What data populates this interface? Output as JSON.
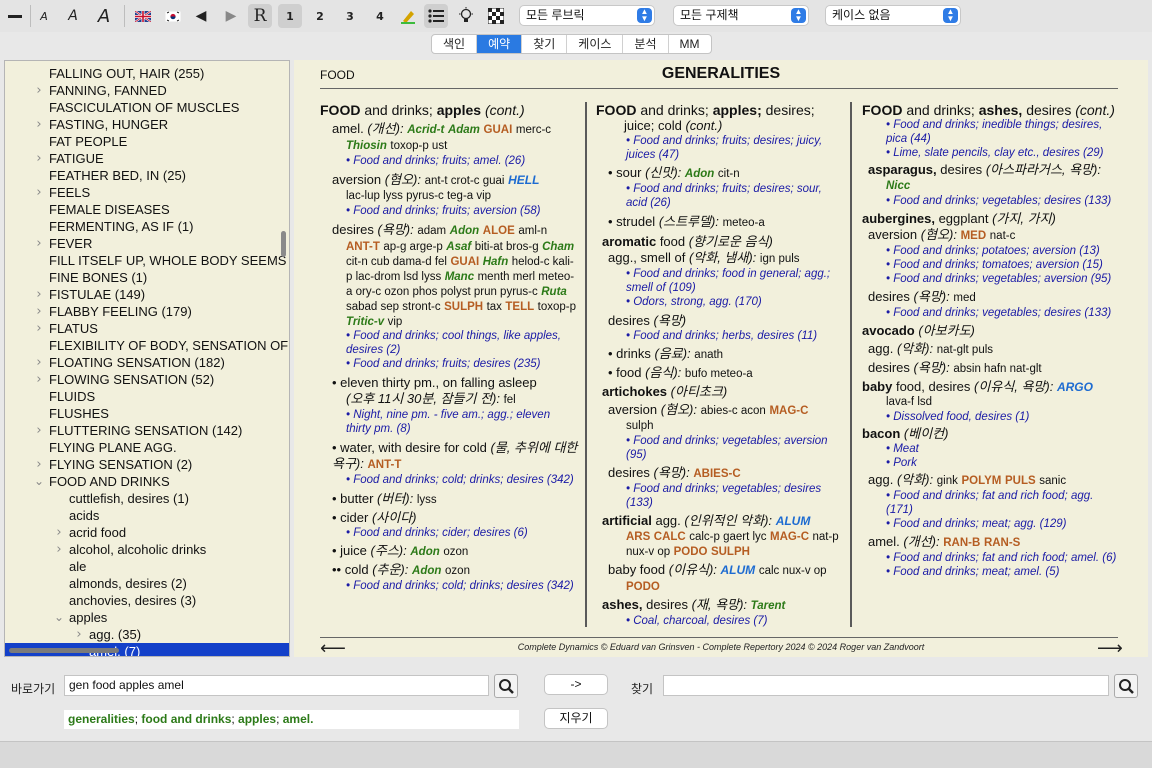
{
  "toolbar": {
    "font_sizes": [
      "A",
      "A",
      "A"
    ],
    "rep_letter": "R",
    "levels": [
      "1",
      "2",
      "3",
      "4"
    ],
    "dropdowns": [
      "모든 루브릭",
      "모든 구제책",
      "케이스 없음"
    ]
  },
  "tabs": [
    "색인",
    "예약",
    "찾기",
    "케이스",
    "분석",
    "MM"
  ],
  "active_tab": "예약",
  "tree": {
    "items": [
      {
        "label": "FALLING OUT, HAIR (255)",
        "expandable": false
      },
      {
        "label": "FANNING, FANNED",
        "expandable": true
      },
      {
        "label": "FASCICULATION OF MUSCLES",
        "expandable": false
      },
      {
        "label": "FASTING, HUNGER",
        "expandable": true
      },
      {
        "label": "FAT PEOPLE",
        "expandable": false
      },
      {
        "label": "FATIGUE",
        "expandable": true
      },
      {
        "label": "FEATHER BED, IN (25)",
        "expandable": false
      },
      {
        "label": "FEELS",
        "expandable": true
      },
      {
        "label": "FEMALE DISEASES",
        "expandable": false
      },
      {
        "label": "FERMENTING, AS IF (1)",
        "expandable": false
      },
      {
        "label": "FEVER",
        "expandable": true
      },
      {
        "label": "FILL ITSELF UP, WHOLE BODY SEEMS",
        "expandable": false
      },
      {
        "label": "FINE BONES (1)",
        "expandable": false
      },
      {
        "label": "FISTULAE (149)",
        "expandable": true
      },
      {
        "label": "FLABBY FEELING (179)",
        "expandable": true
      },
      {
        "label": "FLATUS",
        "expandable": true
      },
      {
        "label": "FLEXIBILITY OF BODY, SENSATION OF",
        "expandable": false
      },
      {
        "label": "FLOATING SENSATION (182)",
        "expandable": true
      },
      {
        "label": "FLOWING SENSATION (52)",
        "expandable": true
      },
      {
        "label": "FLUIDS",
        "expandable": false
      },
      {
        "label": "FLUSHES",
        "expandable": false
      },
      {
        "label": "FLUTTERING SENSATION (142)",
        "expandable": true
      },
      {
        "label": "FLYING PLANE AGG.",
        "expandable": false
      },
      {
        "label": "FLYING SENSATION (2)",
        "expandable": true
      },
      {
        "label": "FOOD AND DRINKS",
        "expandable": true,
        "open": true
      },
      {
        "label": "cuttlefish, desires (1)",
        "level": 1
      },
      {
        "label": "acids",
        "level": 1
      },
      {
        "label": "acrid food",
        "level": 1,
        "expandable": true
      },
      {
        "label": "alcohol, alcoholic drinks",
        "level": 1,
        "expandable": true
      },
      {
        "label": "ale",
        "level": 1
      },
      {
        "label": "almonds, desires (2)",
        "level": 1
      },
      {
        "label": "anchovies, desires (3)",
        "level": 1
      },
      {
        "label": "apples",
        "level": 1,
        "expandable": true,
        "open": true
      },
      {
        "label": "agg. (35)",
        "level": 2,
        "expandable": true
      },
      {
        "label": "amel. (7)",
        "level": 2,
        "selected": true
      }
    ]
  },
  "content": {
    "crumb": "FOOD",
    "title": "GENERALITIES",
    "copyright": "Complete Dynamics © Eduard van Grinsven   -   Complete Repertory 2024 © 2024 Roger van Zandvoort",
    "col1": {
      "heading_bold": "FOOD",
      "heading_mid": " and drinks; ",
      "heading_bold2": "apples",
      "heading_cont": " (cont.)",
      "amel_label": "amel.",
      "amel_kr": "(개선):",
      "amel_r2a": "Acrid-t",
      "amel_r2b": "Adam",
      "amel_r3a": "GUAI",
      "amel_r1a": "merc-c",
      "amel_r2c": "Thiosin",
      "amel_r1b": "toxop-p ust",
      "amel_xref": "• Food and drinks; fruits; amel. (26)",
      "aversion_label": "aversion",
      "aversion_kr": "(혐오):",
      "aversion_r1a": "ant-t crot-c guai",
      "aversion_r4": "HELL",
      "aversion_r1b": "lac-lup lyss pyrus-c teg-a vip",
      "aversion_xref": "• Food and drinks; fruits; aversion (58)",
      "desires_label": "desires",
      "desires_kr": "(욕망):",
      "d_adam": "adam",
      "d_adon": "Adon",
      "d_aloe": "ALOE",
      "d_amln": "aml-n",
      "d_antt": "ANT-T",
      "d_apg": "ap-g arge-p",
      "d_asaf": "Asaf",
      "d_biti": "biti-at bros-g",
      "d_cham": "Cham",
      "d_citn": "cit-n cub dama-d fel",
      "d_guai": "GUAI",
      "d_hafn": "Hafn",
      "d_helod": "helod-c kali-p lac-drom lsd lyss",
      "d_manc": "Manc",
      "d_menth": "menth merl meteo-a ory-c ozon phos polyst prun pyrus-c",
      "d_ruta": "Ruta",
      "d_sabad": "sabad sep stront-c",
      "d_sulph": "SULPH",
      "d_tax": "tax",
      "d_tell": "TELL",
      "d_toxop": "toxop-p",
      "d_tritic": "Tritic-v",
      "d_vip": "vip",
      "desires_xref1": "• Food and drinks; cool things, like apples, desires (2)",
      "desires_xref2": "• Food and drinks; fruits; desires (235)",
      "eleven_label": "• eleven thirty pm., on falling asleep",
      "eleven_kr": "(오후 11시 30분, 잠들기 전):",
      "eleven_r1": "fel",
      "eleven_xref": "• Night, nine pm. - five am.; agg.; eleven thirty pm. (8)",
      "water_label": "• water, with desire for cold",
      "water_kr": "(물, 추위에 대한 욕구):",
      "water_r3": "ANT-T",
      "water_xref": "• Food and drinks; cold; drinks; desires (342)",
      "butter_label": "• butter",
      "butter_kr": "(버터):",
      "butter_r1": "lyss",
      "cider_label": "• cider",
      "cider_kr": "(사이다)",
      "cider_xref": "• Food and drinks; cider; desires (6)",
      "juice_label": "• juice",
      "juice_kr": "(주스):",
      "juice_r2": "Adon",
      "juice_r1": "ozon",
      "cold_label": "•• cold",
      "cold_kr": "(추운):",
      "cold_r2": "Adon",
      "cold_r1": "ozon",
      "cold_xref": "• Food and drinks; cold; drinks; desires (342)"
    },
    "col2": {
      "heading_bold": "FOOD",
      "heading_mid": " and drinks; ",
      "heading_bold2": "apples;",
      "heading_rest": " desires;",
      "juice_line": "juice; cold",
      "juice_cont": "(cont.)",
      "juice_xref": "• Food and drinks; fruits; desires; juicy, juices (47)",
      "sour_label": "• sour",
      "sour_kr": "(신맛):",
      "sour_r2": "Adon",
      "sour_r1": "cit-n",
      "sour_xref": "• Food and drinks; fruits; desires; sour, acid (26)",
      "strudel_label": "• strudel",
      "strudel_kr": "(스트루델):",
      "strudel_r1": "meteo-a",
      "aromatic_bold": "aromatic",
      "aromatic_rest": " food",
      "aromatic_kr": "(향기로운 음식)",
      "smell_label": "agg., smell of",
      "smell_kr": "(악화, 냄새):",
      "smell_r1": "ign puls",
      "smell_xref1": "• Food and drinks; food in general; agg.; smell of (109)",
      "smell_xref2": "• Odors, strong, agg. (170)",
      "desires2_label": "desires",
      "desires2_kr": "(욕망)",
      "desires2_xref": "• Food and drinks; herbs, desires (11)",
      "drinks_label": "• drinks",
      "drinks_kr": "(음료):",
      "drinks_r1": "anath",
      "food_label": "• food",
      "food_kr": "(음식):",
      "food_r1": "bufo meteo-a",
      "artich_bold": "artichokes",
      "artich_kr": "(아티초크)",
      "av_label": "aversion",
      "av_kr": "(혐오):",
      "av_r1": "abies-c acon",
      "av_r3": "MAG-C",
      "av_r1b": "sulph",
      "av_xref": "• Food and drinks; vegetables; aversion (95)",
      "des_label": "desires",
      "des_kr": "(욕망):",
      "des_r3": "ABIES-C",
      "des_xref": "• Food and drinks; vegetables; desires (133)",
      "artif_bold": "artificial",
      "artif_rest": " agg.",
      "artif_kr": "(인위적인 악화):",
      "artif_r4": "ALUM",
      "artif_r3a": "ARS",
      "artif_r3b": "CALC",
      "artif_r1a": "calc-p gaert lyc",
      "artif_r3c": "MAG-C",
      "artif_r1b": "nat-p nux-v op",
      "artif_r3d": "PODO",
      "artif_r3e": "SULPH",
      "baby_label": "baby food",
      "baby_kr": "(이유식):",
      "baby_r4": "ALUM",
      "baby_r1": "calc nux-v op",
      "baby_r3": "PODO",
      "ashes_bold": "ashes,",
      "ashes_rest": " desires",
      "ashes_kr": "(재, 욕망):",
      "ashes_r2": "Tarent",
      "ashes_xref": "• Coal, charcoal, desires (7)"
    },
    "col3": {
      "heading_bold": "FOOD",
      "heading_mid": " and drinks; ",
      "heading_bold2": "ashes,",
      "heading_rest": " desires",
      "heading_cont": "(cont.)",
      "xref1": "• Food and drinks; inedible things; desires, pica (44)",
      "xref2": "• Lime, slate pencils, clay etc., desires (29)",
      "asp_bold": "asparagus,",
      "asp_rest": " desires",
      "asp_kr": "(아스파라거스, 욕망):",
      "asp_r2": "Nicc",
      "asp_xref": "• Food and drinks; vegetables; desires (133)",
      "aub_bold": "aubergines,",
      "aub_rest": " eggplant",
      "aub_kr": "(가지, 가지)",
      "aub_av_label": "aversion",
      "aub_av_kr": "(혐오):",
      "aub_av_r3": "MED",
      "aub_av_r1": "nat-c",
      "aub_av_x1": "• Food and drinks; potatoes; aversion (13)",
      "aub_av_x2": "• Food and drinks; tomatoes; aversion (15)",
      "aub_av_x3": "• Food and drinks; vegetables; aversion (95)",
      "aub_des_label": "desires",
      "aub_des_kr": "(욕망):",
      "aub_des_r1": "med",
      "aub_des_x": "• Food and drinks; vegetables; desires (133)",
      "avo_bold": "avocado",
      "avo_kr": "(아보카도)",
      "avo_agg_label": "agg.",
      "avo_agg_kr": "(악화):",
      "avo_agg_r1": "nat-glt puls",
      "avo_des_label": "desires",
      "avo_des_kr": "(욕망):",
      "avo_des_r1": "absin hafn nat-glt",
      "baby_bold": "baby",
      "baby_rest": " food, desires",
      "baby_kr": "(이유식, 욕망):",
      "baby_r4": "ARGO",
      "baby_r1": "lava-f lsd",
      "baby_x": "• Dissolved food, desires (1)",
      "bacon_bold": "bacon",
      "bacon_kr": "(베이컨)",
      "bacon_x1": "• Meat",
      "bacon_x2": "• Pork",
      "bacon_agg_label": "agg.",
      "bacon_agg_kr": "(악화):",
      "bacon_agg_r1a": "gink",
      "bacon_agg_r3a": "POLYM",
      "bacon_agg_r3b": "PULS",
      "bacon_agg_r1b": "sanic",
      "bacon_agg_x1": "• Food and drinks; fat and rich food; agg. (171)",
      "bacon_agg_x2": "• Food and drinks; meat; agg. (129)",
      "bacon_amel_label": "amel.",
      "bacon_amel_kr": "(개선):",
      "bacon_amel_r3a": "RAN-B",
      "bacon_amel_r3b": "RAN-S",
      "bacon_amel_x1": "• Food and drinks; fat and rich food; amel. (6)",
      "bacon_amel_x2": "• Food and drinks; meat; amel. (5)"
    }
  },
  "bottom": {
    "goto_label": "바로가기",
    "goto_value": "gen food apples amel",
    "arrow_button": "->",
    "clear_button": "지우기",
    "find_label": "찾기",
    "find_value": "",
    "result": [
      "generalities",
      "food and drinks",
      "apples",
      "amel."
    ]
  }
}
